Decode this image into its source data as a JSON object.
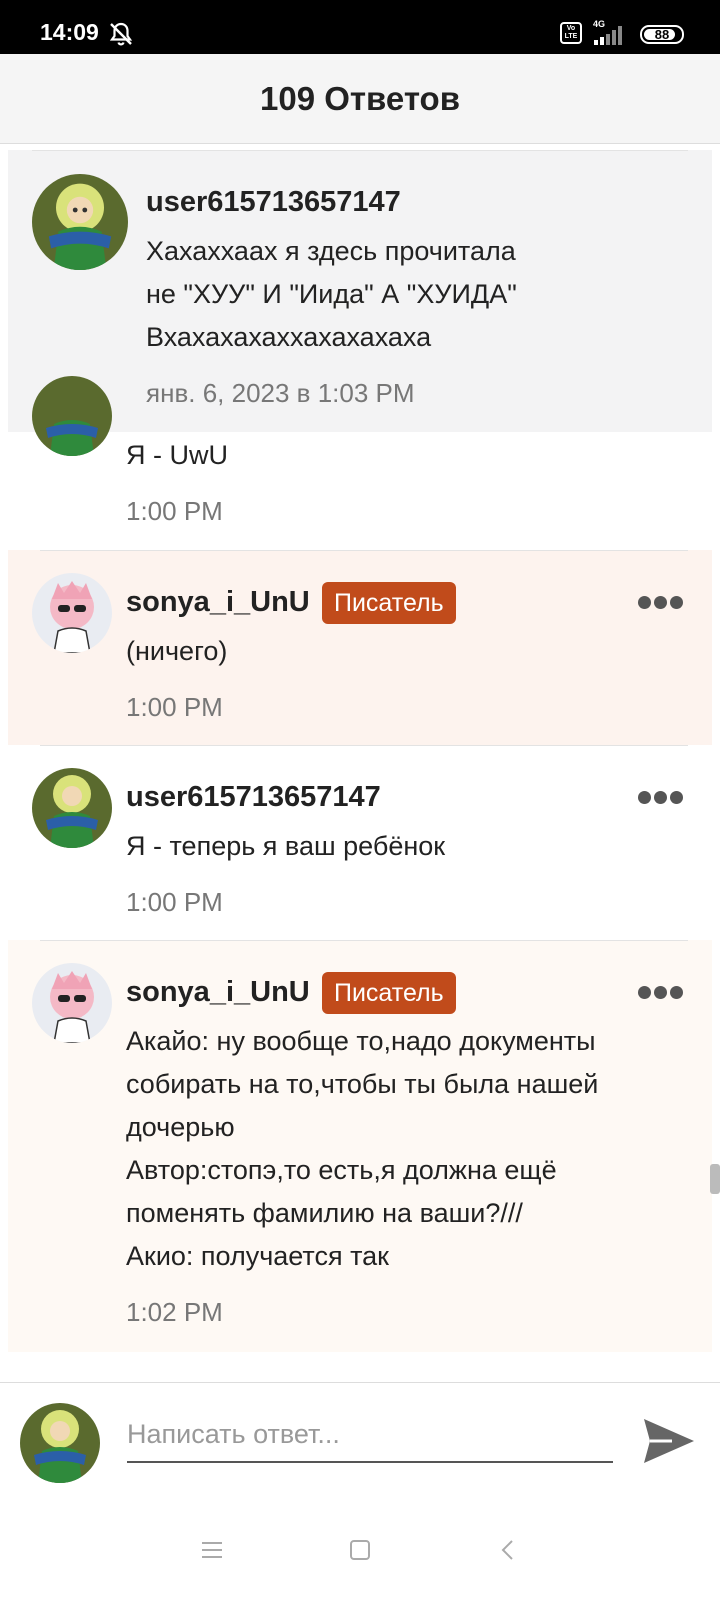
{
  "status_bar": {
    "time": "14:09",
    "battery": "88",
    "battery_level": 0.88,
    "network": "4G",
    "volte": "Vo LTE",
    "icons": [
      "bell-off-icon",
      "volte-icon",
      "signal-icon",
      "battery-icon"
    ]
  },
  "header": {
    "title": "109 Ответов"
  },
  "comments": [
    {
      "username": "user615713657147",
      "lines": [
        "Хахаххаах я здесь прочитала",
        "не \"ХУУ\" И \"Иида\" А \"ХУИДА\"",
        "Вхахахахаххахахахаха"
      ],
      "time": "янв. 6, 2023 в 1:03 PM",
      "highlight": "#f3f3f4"
    },
    {
      "username": "",
      "lines": [
        "Я - UwU"
      ],
      "time": "1:00 PM"
    },
    {
      "username": "sonya_i_UnU",
      "badge": "Писатель",
      "lines": [
        "(ничего)"
      ],
      "time": "1:00 PM",
      "highlight": "#fdf3ee"
    },
    {
      "username": "user615713657147",
      "lines": [
        "Я - теперь я ваш ребёнок"
      ],
      "time": "1:00 PM"
    },
    {
      "username": "sonya_i_UnU",
      "badge": "Писатель",
      "lines": [
        "Акайо: ну вообще то,надо документы",
        "собирать на то,чтобы ты была нашей",
        "дочерью",
        "Автор:стопэ,то есть,я должна ещё",
        "поменять фамилию на ваши?///",
        "Акио: получается так"
      ],
      "time": "1:02 PM",
      "highlight": "#fef9f4"
    }
  ],
  "reply": {
    "placeholder": "Написать ответ..."
  },
  "colors": {
    "badge": "#c14b1b",
    "header_bg": "#f5f5f5"
  }
}
